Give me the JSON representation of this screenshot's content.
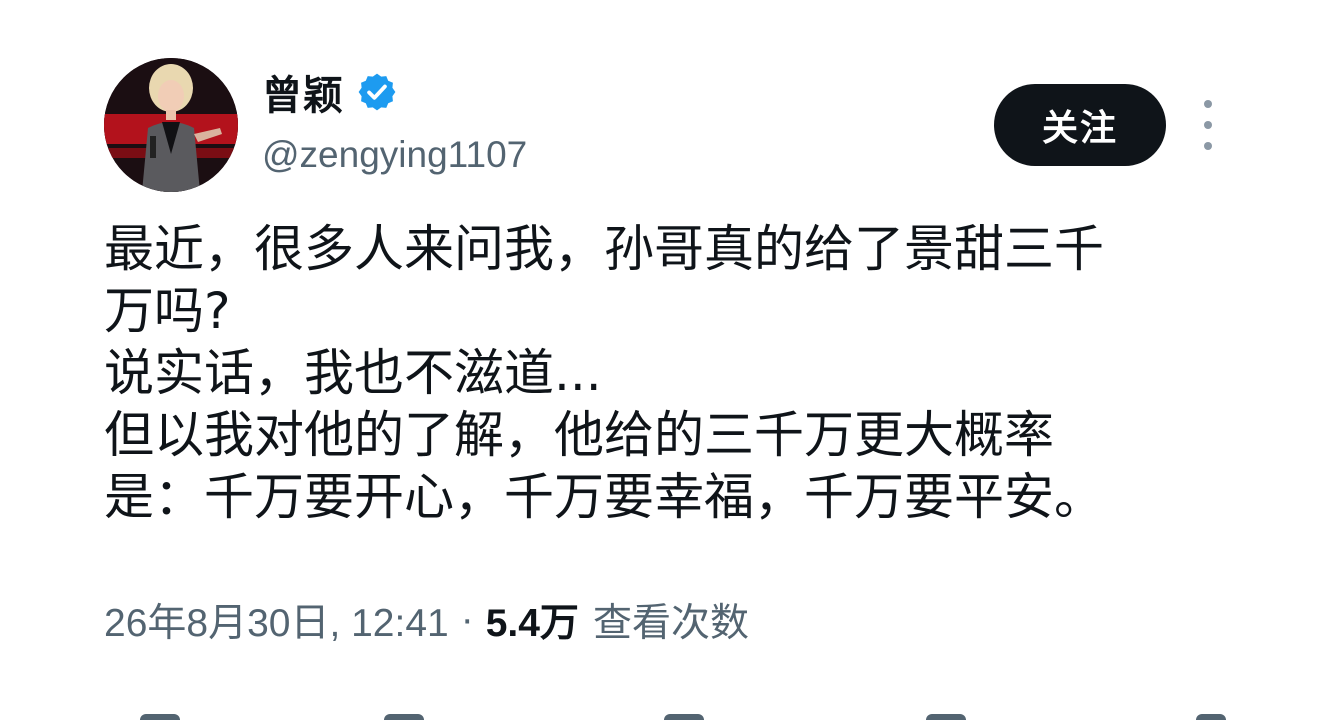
{
  "author": {
    "display_name": "曾颖",
    "handle": "@zengying1107",
    "verified": true
  },
  "follow_button_label": "关注",
  "body": {
    "lines": [
      "最近，很多人来问我，孙哥真的给了景甜三千",
      "万吗?",
      "说实话，我也不滋道...",
      "但以我对他的了解，他给的三千万更大概率",
      "是：千万要开心，千万要幸福，千万要平安。"
    ]
  },
  "meta": {
    "timestamp": "26年8月30日, 12:41",
    "separator": "·",
    "views_count": "5.4万",
    "views_label": "查看次数"
  },
  "icons": {
    "verified": "verified-badge-icon",
    "more": "more-options-icon"
  },
  "colors": {
    "verified_blue": "#1d9bf0",
    "follow_button_bg": "#0f1419",
    "secondary_text": "#536471"
  }
}
